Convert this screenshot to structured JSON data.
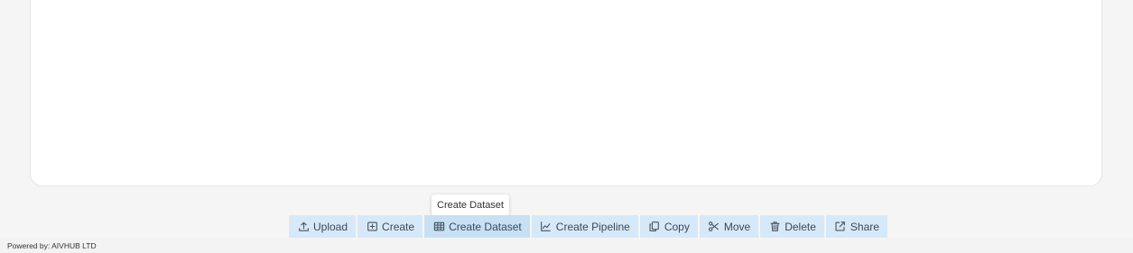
{
  "tooltip": {
    "text": "Create Dataset"
  },
  "toolbar": {
    "buttons": [
      {
        "label": "Upload",
        "icon": "upload-icon"
      },
      {
        "label": "Create",
        "icon": "add-folder-icon"
      },
      {
        "label": "Create Dataset",
        "icon": "table-icon"
      },
      {
        "label": "Create Pipeline",
        "icon": "line-chart-icon"
      },
      {
        "label": "Copy",
        "icon": "copy-icon"
      },
      {
        "label": "Move",
        "icon": "scissors-icon"
      },
      {
        "label": "Delete",
        "icon": "trash-icon"
      },
      {
        "label": "Share",
        "icon": "share-icon"
      }
    ],
    "button_color": "#d6e9f8",
    "hover_color": "#c7e0f4"
  },
  "footer": {
    "powered_by": "Powered by: AIVHUB LTD"
  }
}
